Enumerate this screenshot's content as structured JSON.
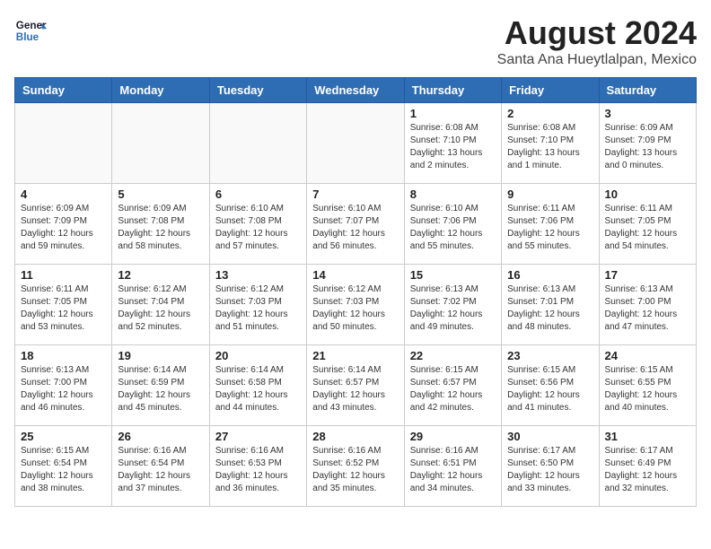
{
  "logo": {
    "text_general": "General",
    "text_blue": "Blue"
  },
  "header": {
    "title": "August 2024",
    "subtitle": "Santa Ana Hueytlalpan, Mexico"
  },
  "days_of_week": [
    "Sunday",
    "Monday",
    "Tuesday",
    "Wednesday",
    "Thursday",
    "Friday",
    "Saturday"
  ],
  "weeks": [
    [
      {
        "day": "",
        "info": ""
      },
      {
        "day": "",
        "info": ""
      },
      {
        "day": "",
        "info": ""
      },
      {
        "day": "",
        "info": ""
      },
      {
        "day": "1",
        "info": "Sunrise: 6:08 AM\nSunset: 7:10 PM\nDaylight: 13 hours\nand 2 minutes."
      },
      {
        "day": "2",
        "info": "Sunrise: 6:08 AM\nSunset: 7:10 PM\nDaylight: 13 hours\nand 1 minute."
      },
      {
        "day": "3",
        "info": "Sunrise: 6:09 AM\nSunset: 7:09 PM\nDaylight: 13 hours\nand 0 minutes."
      }
    ],
    [
      {
        "day": "4",
        "info": "Sunrise: 6:09 AM\nSunset: 7:09 PM\nDaylight: 12 hours\nand 59 minutes."
      },
      {
        "day": "5",
        "info": "Sunrise: 6:09 AM\nSunset: 7:08 PM\nDaylight: 12 hours\nand 58 minutes."
      },
      {
        "day": "6",
        "info": "Sunrise: 6:10 AM\nSunset: 7:08 PM\nDaylight: 12 hours\nand 57 minutes."
      },
      {
        "day": "7",
        "info": "Sunrise: 6:10 AM\nSunset: 7:07 PM\nDaylight: 12 hours\nand 56 minutes."
      },
      {
        "day": "8",
        "info": "Sunrise: 6:10 AM\nSunset: 7:06 PM\nDaylight: 12 hours\nand 55 minutes."
      },
      {
        "day": "9",
        "info": "Sunrise: 6:11 AM\nSunset: 7:06 PM\nDaylight: 12 hours\nand 55 minutes."
      },
      {
        "day": "10",
        "info": "Sunrise: 6:11 AM\nSunset: 7:05 PM\nDaylight: 12 hours\nand 54 minutes."
      }
    ],
    [
      {
        "day": "11",
        "info": "Sunrise: 6:11 AM\nSunset: 7:05 PM\nDaylight: 12 hours\nand 53 minutes."
      },
      {
        "day": "12",
        "info": "Sunrise: 6:12 AM\nSunset: 7:04 PM\nDaylight: 12 hours\nand 52 minutes."
      },
      {
        "day": "13",
        "info": "Sunrise: 6:12 AM\nSunset: 7:03 PM\nDaylight: 12 hours\nand 51 minutes."
      },
      {
        "day": "14",
        "info": "Sunrise: 6:12 AM\nSunset: 7:03 PM\nDaylight: 12 hours\nand 50 minutes."
      },
      {
        "day": "15",
        "info": "Sunrise: 6:13 AM\nSunset: 7:02 PM\nDaylight: 12 hours\nand 49 minutes."
      },
      {
        "day": "16",
        "info": "Sunrise: 6:13 AM\nSunset: 7:01 PM\nDaylight: 12 hours\nand 48 minutes."
      },
      {
        "day": "17",
        "info": "Sunrise: 6:13 AM\nSunset: 7:00 PM\nDaylight: 12 hours\nand 47 minutes."
      }
    ],
    [
      {
        "day": "18",
        "info": "Sunrise: 6:13 AM\nSunset: 7:00 PM\nDaylight: 12 hours\nand 46 minutes."
      },
      {
        "day": "19",
        "info": "Sunrise: 6:14 AM\nSunset: 6:59 PM\nDaylight: 12 hours\nand 45 minutes."
      },
      {
        "day": "20",
        "info": "Sunrise: 6:14 AM\nSunset: 6:58 PM\nDaylight: 12 hours\nand 44 minutes."
      },
      {
        "day": "21",
        "info": "Sunrise: 6:14 AM\nSunset: 6:57 PM\nDaylight: 12 hours\nand 43 minutes."
      },
      {
        "day": "22",
        "info": "Sunrise: 6:15 AM\nSunset: 6:57 PM\nDaylight: 12 hours\nand 42 minutes."
      },
      {
        "day": "23",
        "info": "Sunrise: 6:15 AM\nSunset: 6:56 PM\nDaylight: 12 hours\nand 41 minutes."
      },
      {
        "day": "24",
        "info": "Sunrise: 6:15 AM\nSunset: 6:55 PM\nDaylight: 12 hours\nand 40 minutes."
      }
    ],
    [
      {
        "day": "25",
        "info": "Sunrise: 6:15 AM\nSunset: 6:54 PM\nDaylight: 12 hours\nand 38 minutes."
      },
      {
        "day": "26",
        "info": "Sunrise: 6:16 AM\nSunset: 6:54 PM\nDaylight: 12 hours\nand 37 minutes."
      },
      {
        "day": "27",
        "info": "Sunrise: 6:16 AM\nSunset: 6:53 PM\nDaylight: 12 hours\nand 36 minutes."
      },
      {
        "day": "28",
        "info": "Sunrise: 6:16 AM\nSunset: 6:52 PM\nDaylight: 12 hours\nand 35 minutes."
      },
      {
        "day": "29",
        "info": "Sunrise: 6:16 AM\nSunset: 6:51 PM\nDaylight: 12 hours\nand 34 minutes."
      },
      {
        "day": "30",
        "info": "Sunrise: 6:17 AM\nSunset: 6:50 PM\nDaylight: 12 hours\nand 33 minutes."
      },
      {
        "day": "31",
        "info": "Sunrise: 6:17 AM\nSunset: 6:49 PM\nDaylight: 12 hours\nand 32 minutes."
      }
    ]
  ]
}
